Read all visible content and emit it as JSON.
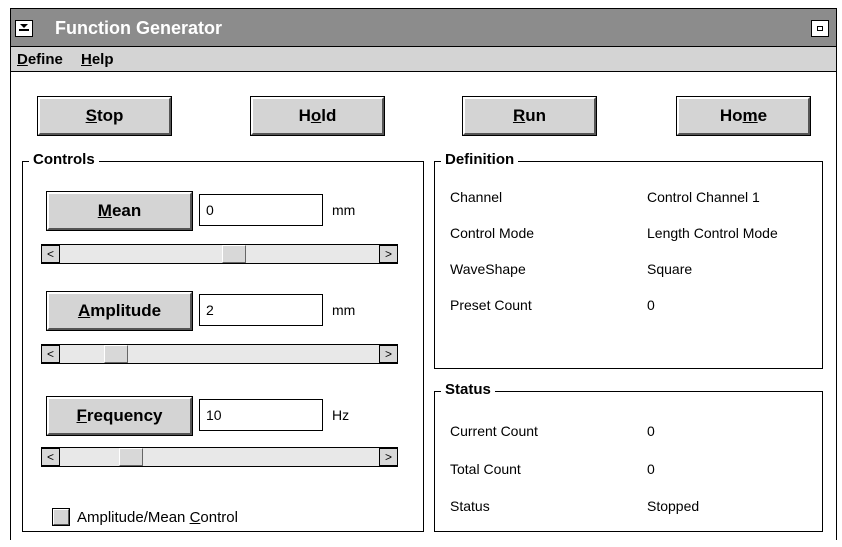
{
  "window": {
    "title": "Function Generator",
    "sysmenu_icon": "system-menu-icon",
    "minimize_icon": "minimize-icon"
  },
  "menubar": {
    "define": {
      "pre": "",
      "u": "D",
      "post": "efine"
    },
    "help": {
      "pre": "",
      "u": "H",
      "post": "elp"
    }
  },
  "toolbar": {
    "stop": {
      "pre": "",
      "u": "S",
      "post": "top"
    },
    "hold": {
      "pre": "H",
      "u": "o",
      "post": "ld"
    },
    "run": {
      "pre": "",
      "u": "R",
      "post": "un"
    },
    "home": {
      "pre": "Ho",
      "u": "m",
      "post": "e"
    }
  },
  "controls": {
    "title": "Controls",
    "mean": {
      "label": {
        "pre": "",
        "u": "M",
        "post": "ean"
      },
      "value": "0",
      "unit": "mm",
      "slider_fraction": 0.55
    },
    "amplitude": {
      "label": {
        "pre": "",
        "u": "A",
        "post": "mplitude"
      },
      "value": "2",
      "unit": "mm",
      "slider_fraction": 0.15
    },
    "frequency": {
      "label": {
        "pre": "",
        "u": "F",
        "post": "requency"
      },
      "value": "10",
      "unit": "Hz",
      "slider_fraction": 0.2
    },
    "checkbox": {
      "pre": "Amplitude/Mean ",
      "u": "C",
      "post": "ontrol",
      "checked": false
    }
  },
  "definition": {
    "title": "Definition",
    "rows": [
      {
        "label": "Channel",
        "value": "Control Channel 1"
      },
      {
        "label": "Control Mode",
        "value": "Length Control Mode"
      },
      {
        "label": "WaveShape",
        "value": "Square"
      },
      {
        "label": "Preset Count",
        "value": "0"
      }
    ]
  },
  "status": {
    "title": "Status",
    "rows": [
      {
        "label": "Current Count",
        "value": "0"
      },
      {
        "label": "Total Count",
        "value": "0"
      },
      {
        "label": "Status",
        "value": "Stopped"
      }
    ]
  },
  "scroll_arrows": {
    "left": "<",
    "right": ">"
  },
  "colors": {
    "titlebar": "#8c8c8c",
    "menubar": "#d4d4d4",
    "button_face": "#d4d4d4"
  }
}
